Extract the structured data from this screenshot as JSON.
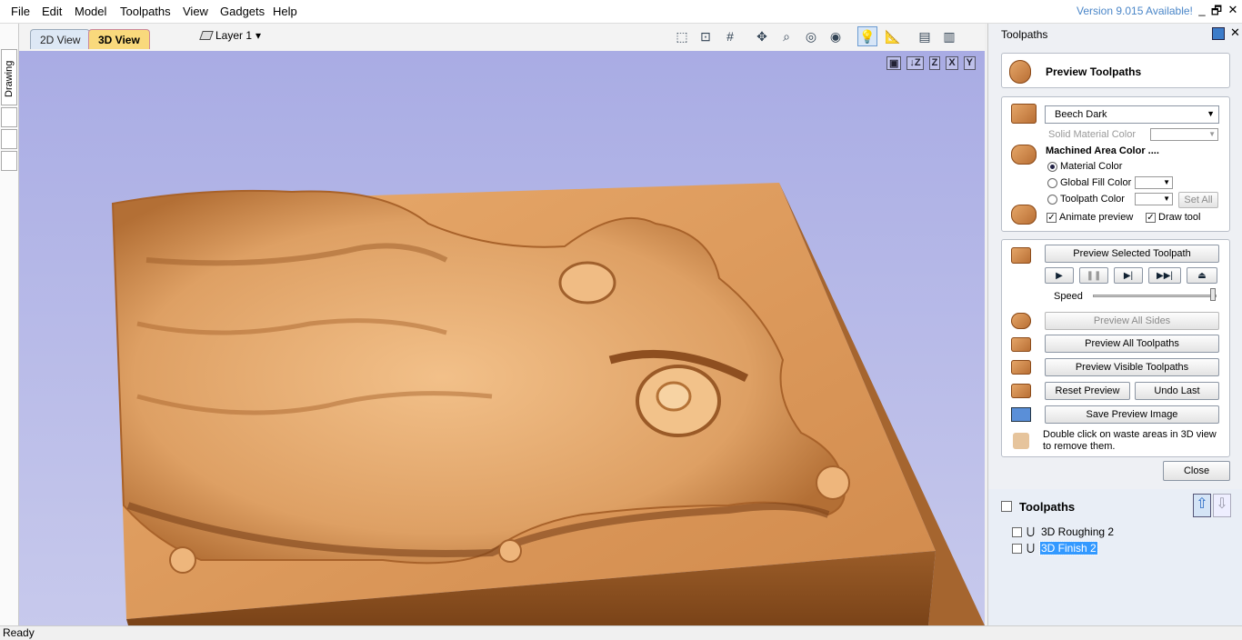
{
  "menu": [
    "File",
    "Edit",
    "Model",
    "Toolpaths",
    "View",
    "Gadgets",
    "Help"
  ],
  "version_notice": "Version 9.015 Available!",
  "window_buttons": [
    "_",
    "🗗",
    "✕"
  ],
  "sidebar_tab": "Drawing",
  "view_tabs": {
    "tab2d": "2D View",
    "tab3d": "3D View"
  },
  "layer": {
    "label": "Layer 1",
    "arrow": "▾"
  },
  "orient_buttons": [
    "▣",
    "↓Z",
    "Z",
    "X",
    "Y"
  ],
  "panel": {
    "title": "Toolpaths",
    "header": "Preview Toolpaths",
    "material": "Beech Dark",
    "solid_material_color": "Solid Material Color",
    "machined_area_color": "Machined Area Color ....",
    "radio_material": "Material Color",
    "radio_global": "Global Fill Color",
    "radio_toolpath": "Toolpath Color",
    "set_all": "Set All",
    "animate_preview": "Animate preview",
    "draw_tool": "Draw tool",
    "preview_selected": "Preview Selected Toolpath",
    "speed": "Speed",
    "preview_all_sides": "Preview All Sides",
    "preview_all_toolpaths": "Preview All Toolpaths",
    "preview_visible_toolpaths": "Preview Visible Toolpaths",
    "reset_preview": "Reset Preview",
    "undo_last": "Undo Last",
    "save_preview_image": "Save Preview Image",
    "hint": "Double click on waste areas in 3D view to remove them.",
    "close": "Close"
  },
  "toolpaths": {
    "title": "Toolpaths",
    "items": [
      {
        "name": "3D Roughing 2",
        "selected": false
      },
      {
        "name": "3D Finish 2",
        "selected": true
      }
    ]
  },
  "status": "Ready",
  "colors": {
    "wood": "#d99a5c",
    "wood_dark": "#8a5324",
    "bg_top": "#a9ace4",
    "accent": "#3399ff"
  }
}
